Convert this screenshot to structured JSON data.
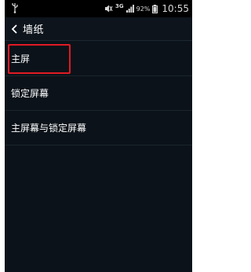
{
  "status_bar": {
    "network": "3G",
    "battery_percent": "92%",
    "time": "10:55"
  },
  "header": {
    "title": "墙纸"
  },
  "menu": {
    "items": [
      {
        "label": "主屏"
      },
      {
        "label": "锁定屏幕"
      },
      {
        "label": "主屏幕与锁定屏幕"
      }
    ]
  },
  "colors": {
    "background": "#0b1219",
    "highlight_border": "#e01b24",
    "text": "#ffffff"
  }
}
